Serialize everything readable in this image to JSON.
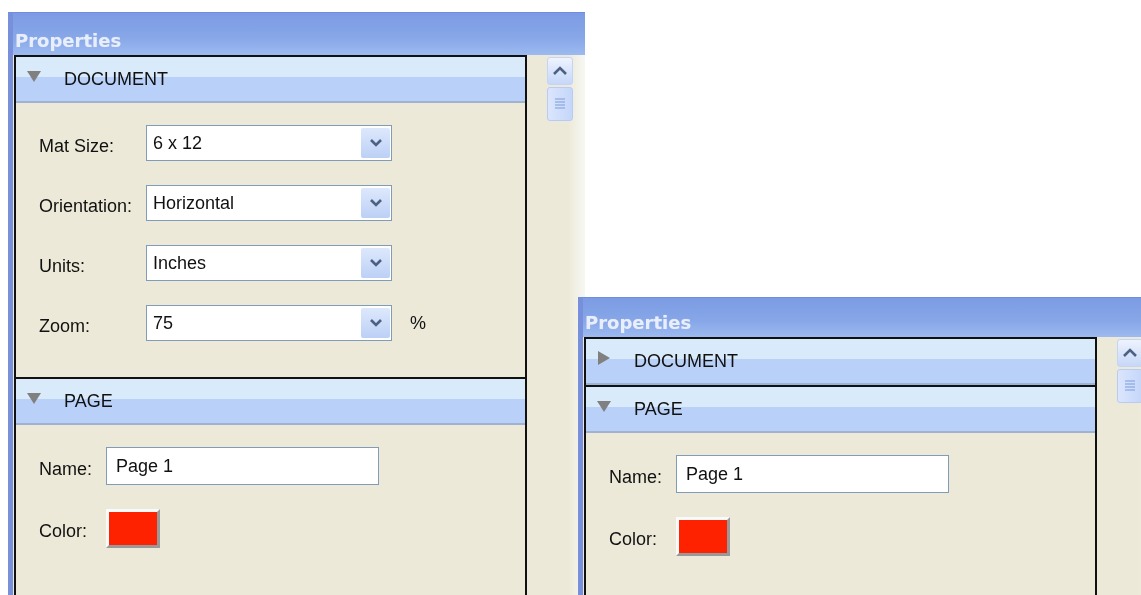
{
  "panels": [
    {
      "title": "Properties",
      "sections": [
        {
          "title": "DOCUMENT",
          "expanded": true,
          "fields": [
            {
              "kind": "select",
              "label": "Mat Size:",
              "value": "6 x 12"
            },
            {
              "kind": "select",
              "label": "Orientation:",
              "value": "Horizontal"
            },
            {
              "kind": "select",
              "label": "Units:",
              "value": "Inches"
            },
            {
              "kind": "select",
              "label": "Zoom:",
              "value": "75",
              "suffix": "%"
            }
          ]
        },
        {
          "title": "PAGE",
          "expanded": true,
          "fields": [
            {
              "kind": "text",
              "label": "Name:",
              "value": "Page 1"
            },
            {
              "kind": "color",
              "label": "Color:",
              "color": "#ff2200"
            }
          ]
        }
      ]
    },
    {
      "title": "Properties",
      "sections": [
        {
          "title": "DOCUMENT",
          "expanded": false
        },
        {
          "title": "PAGE",
          "expanded": true,
          "fields": [
            {
              "kind": "text",
              "label": "Name:",
              "value": "Page 1"
            },
            {
              "kind": "color",
              "label": "Color:",
              "color": "#ff2200"
            }
          ]
        }
      ]
    }
  ]
}
